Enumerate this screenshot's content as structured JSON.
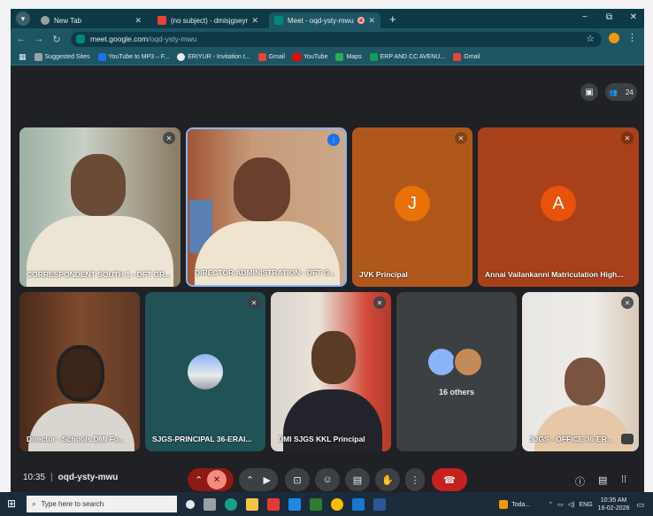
{
  "browser": {
    "tabs": [
      {
        "title": "New Tab",
        "active": false
      },
      {
        "title": "(no subject) - dmisjgseyr@gma",
        "active": false
      },
      {
        "title": "Meet - oqd-ysty-mwu",
        "active": true
      }
    ],
    "new_tab_label": "+",
    "window_controls": {
      "minimize": "−",
      "restore": "⧉",
      "close": "✕"
    },
    "url": {
      "host": "meet.google.com",
      "path": "/oqd-ysty-mwu"
    },
    "bookmarks": [
      {
        "label": "Suggested Sites",
        "color": "#9aa0a6"
      },
      {
        "label": "YouTube to MP3 – F...",
        "color": "#1a73e8"
      },
      {
        "label": "ERIYUR - Invitation t...",
        "color": "#e8eaed"
      },
      {
        "label": "Gmail",
        "color": "#ea4335"
      },
      {
        "label": "YouTube",
        "color": "#ff0000"
      },
      {
        "label": "Maps",
        "color": "#34a853"
      },
      {
        "label": "ERP AND CC AVENU...",
        "color": "#0f9d58"
      },
      {
        "label": "Gmail",
        "color": "#ea4335"
      }
    ]
  },
  "meet": {
    "participant_count": "24",
    "participants": [
      {
        "name": "CORRESPONDENT SOUTH 1 - DFT GR...",
        "kind": "video",
        "muted": true
      },
      {
        "name": "DIRECTOR ADMINISTRATION - DFT G...",
        "kind": "video",
        "muted": false
      },
      {
        "name": "JVK Principal",
        "kind": "avatar",
        "initial": "J",
        "muted": true
      },
      {
        "name": "Annai Vailankanni Matriculation High...",
        "kind": "avatar",
        "initial": "A",
        "muted": true
      },
      {
        "name": "Director - Schools DMI Fo...",
        "kind": "video",
        "muted": false
      },
      {
        "name": "SJGS-PRINCIPAL 36-ERAI...",
        "kind": "image",
        "muted": true
      },
      {
        "name": "DMI SJGS KKL Principal",
        "kind": "video",
        "muted": true
      },
      {
        "name": "16 others",
        "kind": "others",
        "muted": false
      },
      {
        "name": "SJGS - OFFICE 36-ER...",
        "kind": "video",
        "muted": true
      }
    ],
    "time": "10:35",
    "meeting_code": "oqd-ysty-mwu",
    "colors": {
      "accent_orange": "#e8710a",
      "danger_red": "#c5221f",
      "bg": "#202124"
    }
  },
  "taskbar": {
    "search_placeholder": "Type here to search",
    "weather": "Toda...",
    "lang": "ENG",
    "clock_time": "10:35 AM",
    "clock_date": "16-02-2026"
  }
}
